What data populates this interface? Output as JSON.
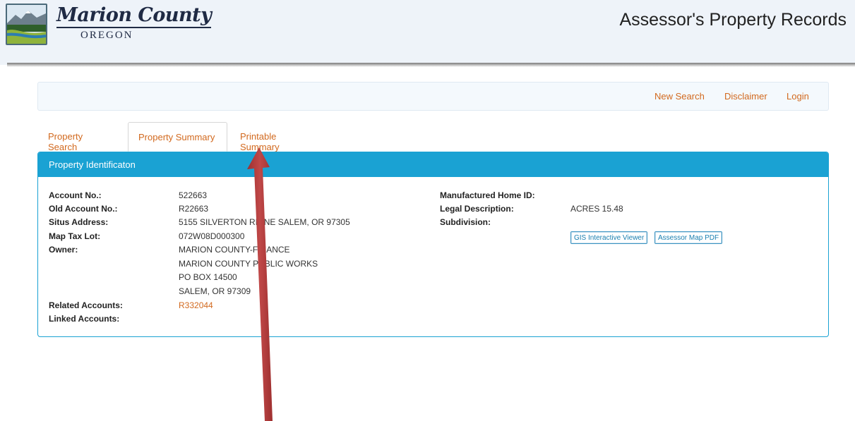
{
  "header": {
    "logo_title": "Marion County",
    "logo_subtitle": "OREGON",
    "app_title": "Assessor's Property Records"
  },
  "nav": {
    "new_search": "New Search",
    "disclaimer": "Disclaimer",
    "login": "Login"
  },
  "tabs": [
    {
      "label": "Property Search",
      "active": false
    },
    {
      "label": "Property Summary",
      "active": true
    },
    {
      "label": "Printable Summary",
      "active": false
    }
  ],
  "panel": {
    "title": "Property Identificaton",
    "left_fields": {
      "account_no_label": "Account No.:",
      "account_no": "522663",
      "old_account_label": "Old Account No.:",
      "old_account": "R22663",
      "situs_label": "Situs Address:",
      "situs": "5155 SILVERTON RD NE SALEM, OR 97305",
      "map_tax_lot_label": "Map Tax Lot:",
      "map_tax_lot": "072W08D000300",
      "owner_label": "Owner:",
      "owner_lines": [
        "MARION COUNTY-FINANCE",
        "MARION COUNTY PUBLIC WORKS",
        "PO BOX 14500",
        "SALEM, OR 97309"
      ],
      "related_label": "Related Accounts:",
      "related": "R332044",
      "linked_label": "Linked Accounts:"
    },
    "right_fields": {
      "mfg_home_label": "Manufactured Home ID:",
      "legal_label": "Legal Description:",
      "legal": "ACRES 15.48",
      "subdivision_label": "Subdivision:"
    },
    "buttons": {
      "gis": "GIS Interactive Viewer",
      "map_pdf": "Assessor Map PDF"
    }
  },
  "annotation": {
    "arrow_color": "#b33a3a",
    "icon": "arrow-up-icon"
  }
}
